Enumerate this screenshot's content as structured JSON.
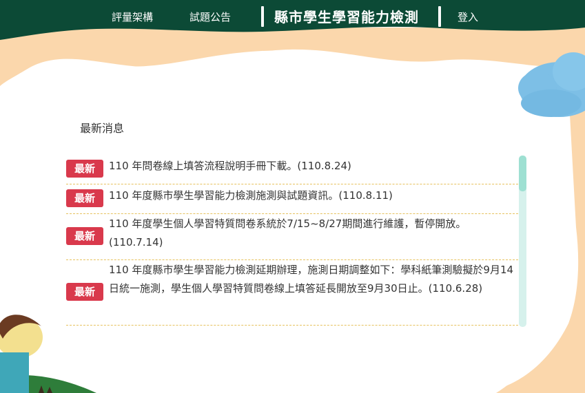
{
  "colors": {
    "header_green": "#0c4a36",
    "badge_red": "#d9394c",
    "divider": "#e6c15c",
    "cloud_blue": "#7dbfe6"
  },
  "nav": {
    "items": [
      {
        "label": "評量架構"
      },
      {
        "label": "試題公告"
      }
    ],
    "site_title": "縣市學生學習能力檢測",
    "login_label": "登入"
  },
  "section": {
    "title": "最新消息"
  },
  "news": [
    {
      "badge": "最新",
      "text": "110 年問卷線上填答流程說明手冊下載。(110.8.24)"
    },
    {
      "badge": "最新",
      "text": "110 年度縣市學生學習能力檢測施測與試題資訊。(110.8.11)"
    },
    {
      "badge": "最新",
      "text": "110 年度學生個人學習特質問卷系統於7/15~8/27期間進行維護，暫停開放。(110.7.14)"
    },
    {
      "badge": "最新",
      "text": "110 年度縣市學生學習能力檢測延期辦理，施測日期調整如下：學科紙筆測驗擬於9月14日統一施測，學生個人學習特質問卷線上填答延長開放至9月30日止。(110.6.28)"
    }
  ],
  "icons": [
    "cloud-illustration",
    "cartoon-child-illustration",
    "scrollbar"
  ]
}
